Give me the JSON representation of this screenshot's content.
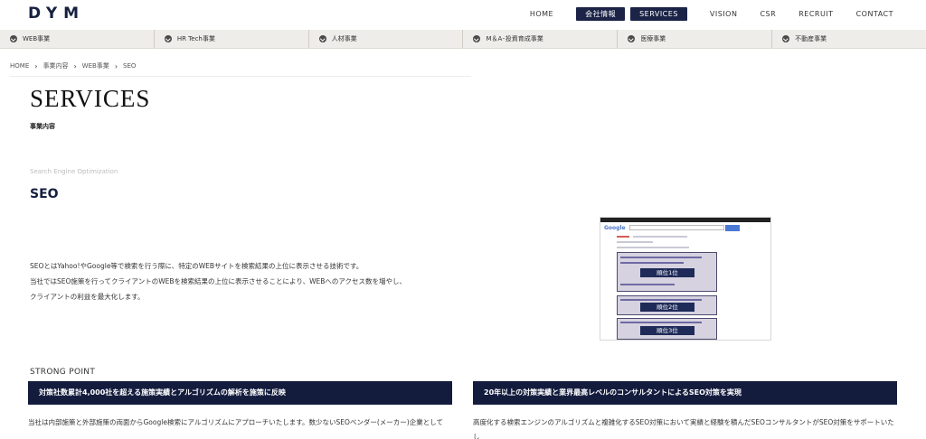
{
  "header": {
    "logo": "DYM",
    "nav": [
      {
        "label": "HOME",
        "style": "plain"
      },
      {
        "label": "会社情報",
        "style": "boxed"
      },
      {
        "label": "SERVICES",
        "style": "boxed"
      },
      {
        "label": "VISION",
        "style": "plain"
      },
      {
        "label": "CSR",
        "style": "plain"
      },
      {
        "label": "RECRUIT",
        "style": "plain"
      },
      {
        "label": "CONTACT",
        "style": "plain"
      }
    ]
  },
  "subnav": [
    "WEB事業",
    "HR Tech事業",
    "人材事業",
    "M＆A･投資育成事業",
    "医療事業",
    "不動産事業"
  ],
  "breadcrumb": [
    "HOME",
    "事業内容",
    "WEB事業",
    "SEO"
  ],
  "page": {
    "title": "SERVICES",
    "subtitle": "事業内容",
    "section_en": "Search Engine Optimization",
    "section_title": "SEO",
    "description": [
      "SEOとはYahoo!やGoogle等で検索を行う際に、特定のWEBサイトを検索結果の上位に表示させる技術です。",
      "当社ではSEO施策を行ってクライアントのWEBを検索結果の上位に表示させることにより、WEBへのアクセス数を増やし、",
      "クライアントの利益を最大化します。"
    ]
  },
  "serp": {
    "search_logo": "Google",
    "ranks": [
      "順位1位",
      "順位2位",
      "順位3位"
    ]
  },
  "strong_point": {
    "label": "STRONG POINT",
    "cards": [
      {
        "heading": "対策社数累計4,000社を超える施策実績とアルゴリズムの解析を施策に反映",
        "text": "当社は内部施策と外部施策の両面からGoogle検索にアルゴリズムにアプローチいたします。数少ないSEOベンダー(メーカー)企業として"
      },
      {
        "heading": "20年以上の対策実績と業界最高レベルのコンサルタントによるSEO対策を実現",
        "text": "高度化する検索エンジンのアルゴリズムと複雑化するSEO対策において実績と経験を積んだSEOコンサルタントがSEO対策をサポートいたし"
      }
    ]
  },
  "colors": {
    "navy": "#141c3e",
    "subnav_bg": "#eeedea"
  }
}
